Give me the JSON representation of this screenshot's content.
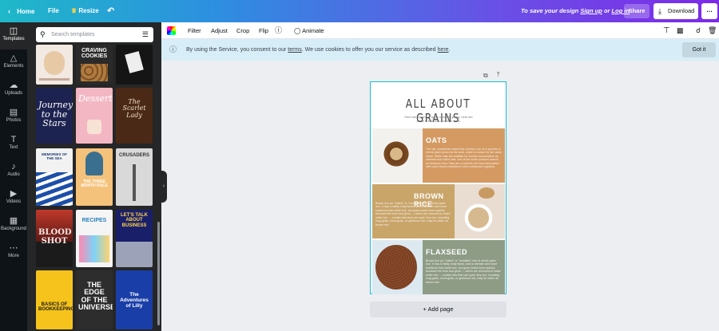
{
  "topbar": {
    "home": "Home",
    "file": "File",
    "resize": "Resize",
    "message_prefix": "To save your design",
    "sign_up": "Sign up",
    "or": "or",
    "log_in": "Log in",
    "share": "Share",
    "download": "Download"
  },
  "rail": [
    {
      "label": "Templates",
      "icon": "templates-icon"
    },
    {
      "label": "Elements",
      "icon": "elements-icon"
    },
    {
      "label": "Uploads",
      "icon": "uploads-icon"
    },
    {
      "label": "Photos",
      "icon": "photos-icon"
    },
    {
      "label": "Text",
      "icon": "text-icon"
    },
    {
      "label": "Audio",
      "icon": "audio-icon"
    },
    {
      "label": "Videos",
      "icon": "videos-icon"
    },
    {
      "label": "Background",
      "icon": "background-icon"
    },
    {
      "label": "More",
      "icon": "more-icon"
    }
  ],
  "search": {
    "placeholder": "Search templates"
  },
  "templates": [
    {
      "title": "",
      "bg": "#f2e9e2"
    },
    {
      "title": "CRAVING COOKIES",
      "bg": "#2a2a2a"
    },
    {
      "title": "",
      "bg": "#151515"
    },
    {
      "title": "Journey to the Stars",
      "bg": "#1d2350"
    },
    {
      "title": "Desserts",
      "bg": "#f3b7c3"
    },
    {
      "title": "The Scarlet Lady",
      "bg": "#4a2a17"
    },
    {
      "title": "MEMORIES OF THE SEA",
      "bg": "#f2f2f2"
    },
    {
      "title": "THE THREE MONTH RULE",
      "bg": "#f4c27a"
    },
    {
      "title": "CRUSADERS",
      "bg": "#d9d9d9"
    },
    {
      "title": "BLOOD SHOT",
      "bg": "#1b1b1b"
    },
    {
      "title": "RECIPES",
      "bg": "#f5f5f5"
    },
    {
      "title": "LET'S TALK ABOUT BUSINESS",
      "bg": "#1a1f6a"
    },
    {
      "title": "BASICS OF BOOKKEEPING",
      "bg": "#f5c31b"
    },
    {
      "title": "THE EDGE OF THE UNIVERSE",
      "bg": "#2d2d2d"
    },
    {
      "title": "The Adventures of Lilly",
      "bg": "#1a3ea8"
    }
  ],
  "toolbar": {
    "filter": "Filter",
    "adjust": "Adjust",
    "crop": "Crop",
    "flip": "Flip",
    "animate": "Animate"
  },
  "notice": {
    "text_before": "By using the Service, you consent to our",
    "terms": "terms",
    "text_middle": ". We use cookies to offer you our service as described",
    "here": "here",
    "text_end": ".",
    "got_it": "Got it"
  },
  "design": {
    "title": "ALL ABOUT GRAINS",
    "subtitle": "Here are dozens of types of whole grains, here are some of the most common ones.",
    "sections": [
      {
        "heading": "OATS",
        "body": "The oat, sometimes called the common oat, is a species of cereal grain grown for its seed, which is known by the same name. While oats are suitable for human consumption as oatmeal and rolled oats, one of the most common uses is as livestock feed. Oats are a nutrient-rich food associated with lower blood cholesterol when consumed regularly."
      },
      {
        "heading": "BROWN RICE",
        "body": "Brown rice (or \"hulled\" or \"unmilled\" rice) is whole grain rice. It has a mildly nutty flavor, and is chewier and more nutritious than white rice, but goes rancid more quickly because the bran and germ — which are removed to make white rice — contain fats that can spoil. Any rice, including long-grain, short-grain, or glutinous rice, may be eaten as brown rice."
      },
      {
        "heading": "FLAXSEED",
        "body": "Brown rice (or \"hulled\" or \"unmilled\" rice) is whole grain rice. It has a mildly nutty flavor, and is chewier and more nutritious than white rice, but goes rancid more quickly because the bran and germ — which are removed to make white rice — contain fats that can spoil. Any rice, including long-grain, short-grain, or glutinous rice, may be eaten as brown rice."
      }
    ]
  },
  "add_page": "+ Add page",
  "colors": {
    "oats": "#d49a62",
    "rice": "#c9a56a",
    "flax": "#8e9c86"
  }
}
